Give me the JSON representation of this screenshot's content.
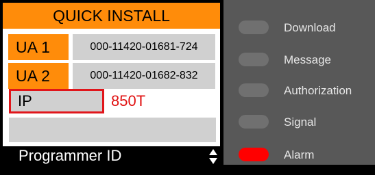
{
  "header": {
    "title": "QUICK INSTALL"
  },
  "rows": {
    "ua1": {
      "label": "UA 1",
      "value": "000-11420-01681-724"
    },
    "ua2": {
      "label": "UA 2",
      "value": "000-11420-01682-832"
    },
    "ip": {
      "label": "IP",
      "value": "850T"
    },
    "empty": {
      "value": ""
    }
  },
  "footer": {
    "label": "Programmer ID",
    "scroll_icon": "up-down-arrows"
  },
  "indicators": [
    {
      "label": "Download",
      "on": false
    },
    {
      "label": "Message",
      "on": false
    },
    {
      "label": "Authorization",
      "on": false
    },
    {
      "label": "Signal",
      "on": false
    },
    {
      "label": "Alarm",
      "on": true,
      "color": "#ff0000"
    }
  ],
  "colors": {
    "accent": "#ff8c0a",
    "highlight": "#e0161b",
    "value_red": "#e01010",
    "panel": "#585858"
  }
}
